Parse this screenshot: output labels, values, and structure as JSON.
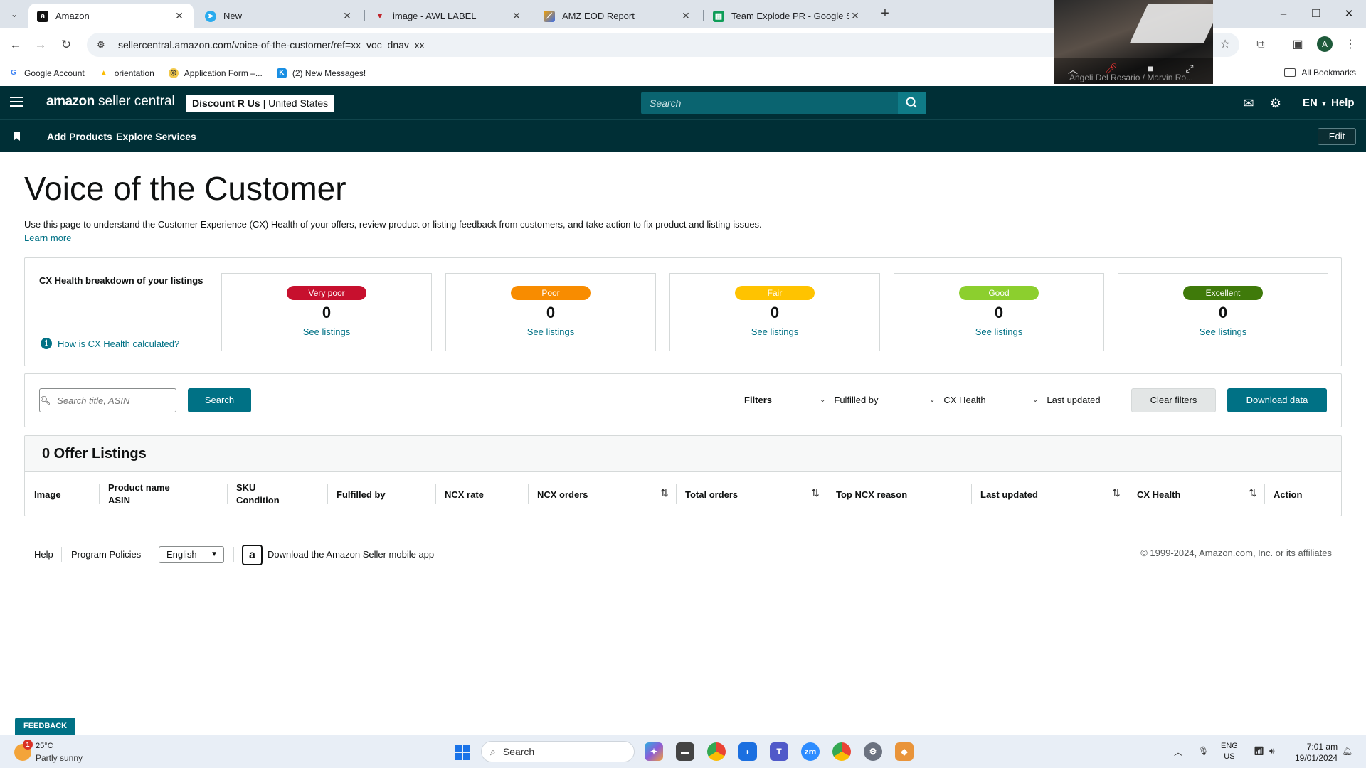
{
  "browser": {
    "tabs": [
      {
        "title": "Amazon",
        "icon": "amazon-icon",
        "active": true
      },
      {
        "title": "New",
        "icon": "telegram-icon"
      },
      {
        "title": "image - AWL LABEL",
        "icon": "label-icon"
      },
      {
        "title": "AMZ EOD Report",
        "icon": "report-icon"
      },
      {
        "title": "Team Explode PR - Google She",
        "icon": "sheets-icon"
      }
    ],
    "url": "sellercentral.amazon.com/voice-of-the-customer/ref=xx_voc_dnav_xx",
    "profile_initial": "A",
    "bookmarks": [
      {
        "label": "Google Account",
        "icon": "google-icon"
      },
      {
        "label": "orientation",
        "icon": "drive-icon"
      },
      {
        "label": "Application Form –...",
        "icon": "form-icon"
      },
      {
        "label": "(2) New Messages!",
        "icon": "messages-icon"
      }
    ],
    "all_bookmarks": "All Bookmarks"
  },
  "video_overlay": {
    "participants": "Angeli Del Rosario / Marvin Ro..."
  },
  "header": {
    "logo_bold": "amazon",
    "logo_light": " seller central",
    "store_name": "Discount R Us",
    "store_region": "United States",
    "search_placeholder": "Search",
    "language": "EN",
    "help": "Help"
  },
  "subnav": {
    "links": [
      "Add Products",
      "Explore Services"
    ],
    "edit": "Edit"
  },
  "main": {
    "title": "Voice of the Customer",
    "description": "Use this page to understand the Customer Experience (CX) Health of your offers, review product or listing feedback from customers, and take action to fix product and listing issues.",
    "learn_more": "Learn more"
  },
  "health": {
    "title": "CX Health breakdown of your listings",
    "how_link": "How is CX Health calculated?",
    "cards": [
      {
        "label": "Very poor",
        "count": "0",
        "link": "See listings",
        "color": "#c7102e",
        "text_color": "#ffffff"
      },
      {
        "label": "Poor",
        "count": "0",
        "link": "See listings",
        "color": "#f88c00",
        "text_color": "#ffffff"
      },
      {
        "label": "Fair",
        "count": "0",
        "link": "See listings",
        "color": "#ffc300",
        "text_color": "#ffffff"
      },
      {
        "label": "Good",
        "count": "0",
        "link": "See listings",
        "color": "#8ccf2e",
        "text_color": "#ffffff"
      },
      {
        "label": "Excellent",
        "count": "0",
        "link": "See listings",
        "color": "#3f7a0a",
        "text_color": "#ffffff"
      }
    ]
  },
  "filters": {
    "search_placeholder": "Search title, ASIN",
    "search_button": "Search",
    "label": "Filters",
    "dropdowns": [
      "Fulfilled by",
      "CX Health",
      "Last updated"
    ],
    "clear": "Clear filters",
    "download": "Download data"
  },
  "listings": {
    "heading": "0 Offer Listings",
    "columns": {
      "image": "Image",
      "product_name": "Product name",
      "asin": "ASIN",
      "sku": "SKU",
      "condition": "Condition",
      "fulfilled_by": "Fulfilled by",
      "ncx_rate": "NCX rate",
      "ncx_orders": "NCX orders",
      "total_orders": "Total orders",
      "top_ncx_reason": "Top NCX reason",
      "last_updated": "Last updated",
      "cx_health": "CX Health",
      "action": "Action"
    }
  },
  "footer": {
    "help": "Help",
    "program_policies": "Program Policies",
    "language": "English",
    "app_download": "Download the Amazon Seller mobile app",
    "copyright": "© 1999-2024, Amazon.com, Inc. or its affiliates"
  },
  "feedback": "FEEDBACK",
  "taskbar": {
    "weather_temp": "25°C",
    "weather_desc": "Partly sunny",
    "weather_badge": "1",
    "search_label": "Search",
    "lang_line1": "ENG",
    "lang_line2": "US",
    "time": "7:01 am",
    "date": "19/01/2024"
  },
  "colors": {
    "header_bg": "#002f36",
    "accent": "#007185"
  }
}
